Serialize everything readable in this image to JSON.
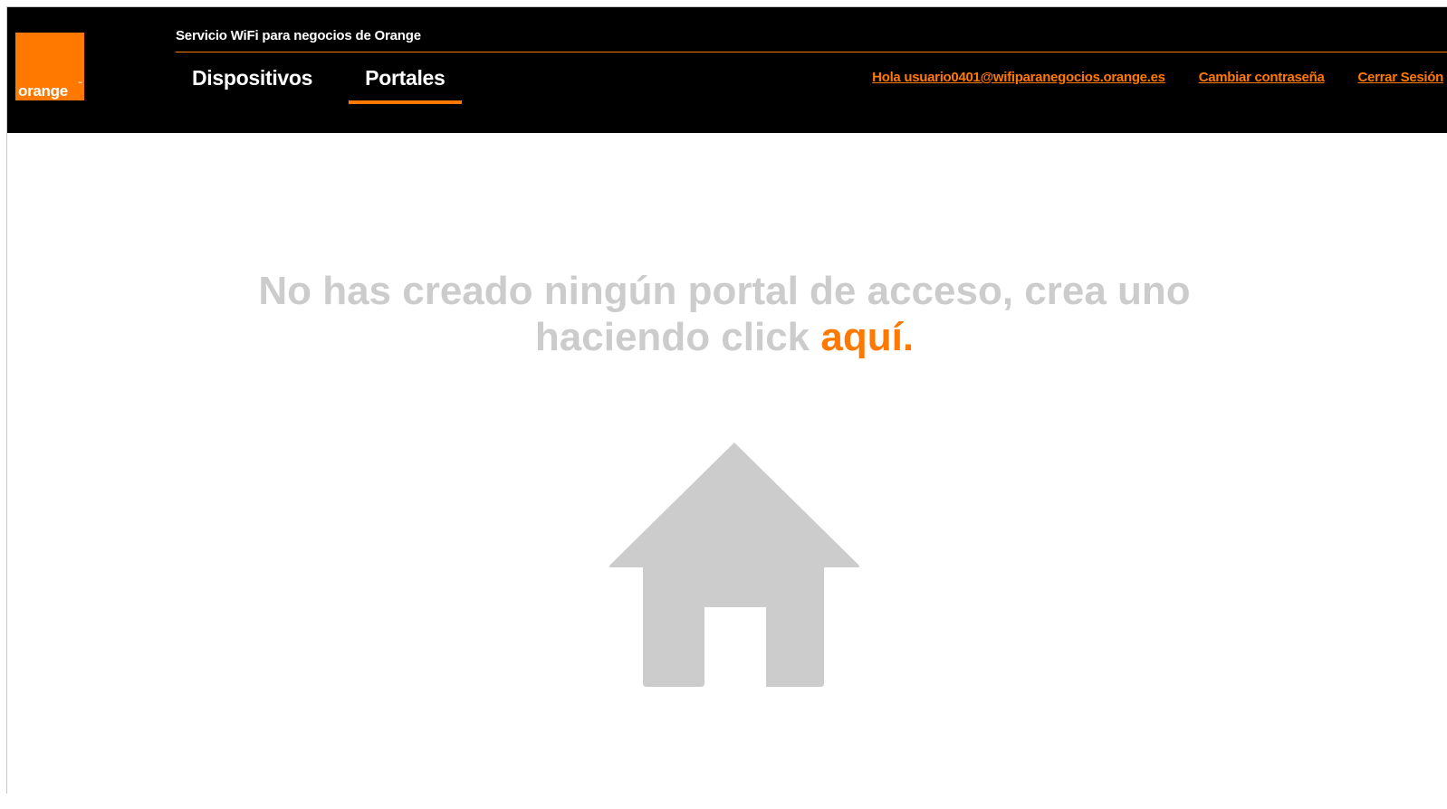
{
  "header": {
    "logo": {
      "text": "orange",
      "tm": "™"
    },
    "service_title": "Servicio WiFi para negocios de Orange",
    "nav": {
      "dispositivos": "Dispositivos",
      "portales": "Portales",
      "active": "Portales"
    },
    "user_links": {
      "greeting": "Hola usuario0401@wifiparanegocios.orange.es",
      "change_password": "Cambiar contraseña",
      "logout": "Cerrar Sesión"
    }
  },
  "main": {
    "empty_message_line1": "No has creado ningún portal de acceso, crea uno",
    "empty_message_line2": "haciendo click ",
    "create_link": "aquí.",
    "illustration": "home-icon"
  },
  "colors": {
    "brand_orange": "#ff7900",
    "header_bg": "#000000",
    "muted_gray": "#cccccc"
  }
}
